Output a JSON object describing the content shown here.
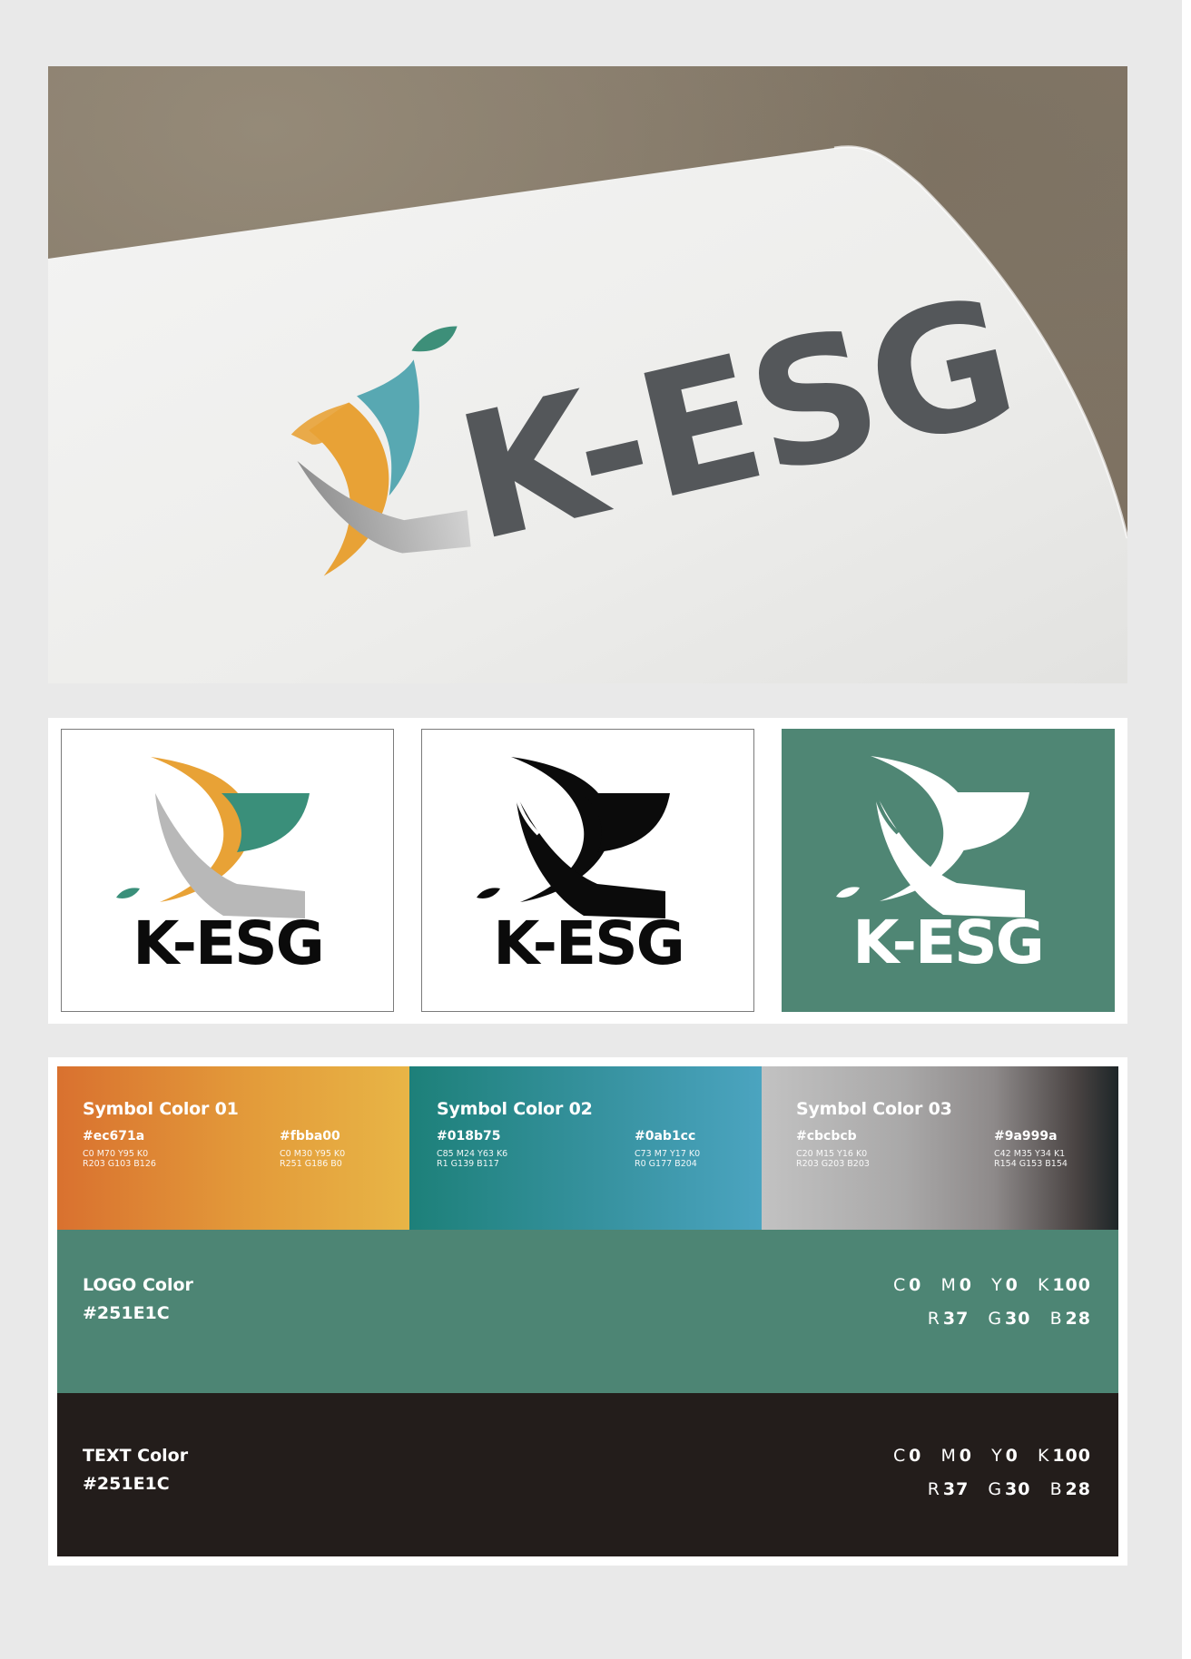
{
  "brand": {
    "wordmark": "K-ESG"
  },
  "colors": {
    "mockup_text": "#54575a",
    "orange": "#e8a236",
    "teal": "#3a8f7a",
    "grey": "#b8b8b8",
    "black": "#0b0b0b",
    "logo_bg": "#4f8674"
  },
  "logo_variants": [
    {
      "name": "color",
      "background": "#ffffff"
    },
    {
      "name": "black",
      "background": "#ffffff"
    },
    {
      "name": "reversed",
      "background": "#4f8674"
    }
  ],
  "palette": {
    "symbol_colors": [
      {
        "title": "Symbol Color 01",
        "primary": {
          "hex": "#ec671a",
          "cmyk": "C0 M70 Y95 K0",
          "rgb": "R203 G103 B126"
        },
        "secondary": {
          "hex": "#fbba00",
          "cmyk": "C0 M30 Y95 K0",
          "rgb": "R251 G186 B0"
        }
      },
      {
        "title": "Symbol Color 02",
        "primary": {
          "hex": "#018b75",
          "cmyk": "C85 M24 Y63 K6",
          "rgb": "R1 G139 B117"
        },
        "secondary": {
          "hex": "#0ab1cc",
          "cmyk": "C73 M7 Y17 K0",
          "rgb": "R0 G177 B204"
        }
      },
      {
        "title": "Symbol Color 03",
        "primary": {
          "hex": "#cbcbcb",
          "cmyk": "C20 M15 Y16 K0",
          "rgb": "R203 G203 B203"
        },
        "secondary": {
          "hex": "#9a999a",
          "cmyk": "C42 M35 Y34 K1",
          "rgb": "R154 G153 B154"
        }
      }
    ],
    "logo_color": {
      "title": "LOGO Color",
      "hex": "#251E1C",
      "c": "0",
      "m": "0",
      "y": "0",
      "k": "100",
      "r": "37",
      "g": "30",
      "b": "28"
    },
    "text_color": {
      "title": "TEXT Color",
      "hex": "#251E1C",
      "c": "0",
      "m": "0",
      "y": "0",
      "k": "100",
      "r": "37",
      "g": "30",
      "b": "28"
    }
  }
}
